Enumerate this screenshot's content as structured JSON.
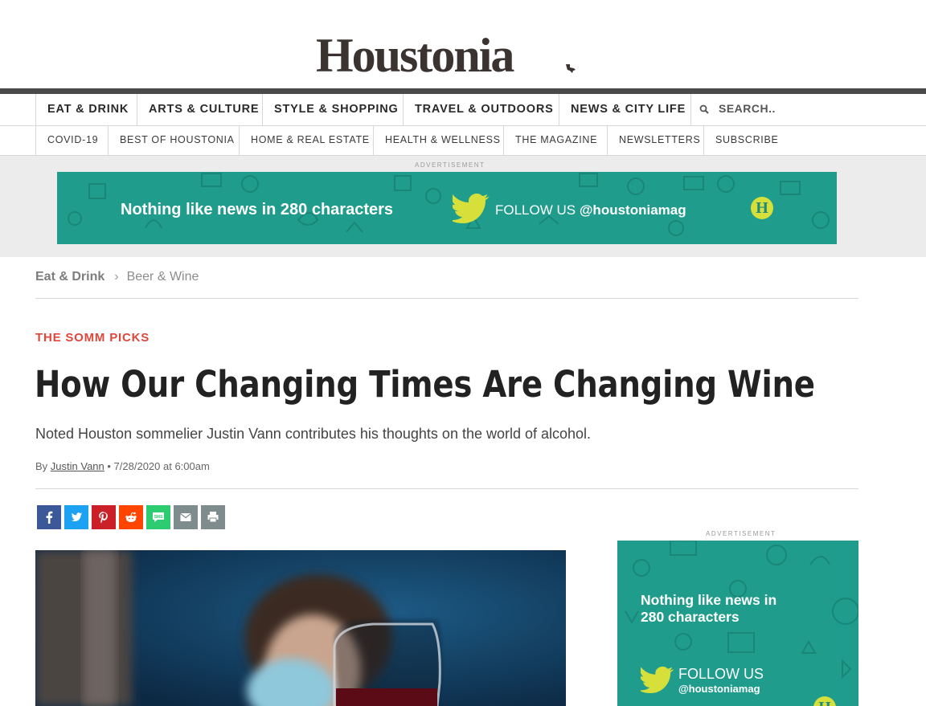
{
  "brand": {
    "logo_text": "Houstonia"
  },
  "primary_nav": {
    "items": [
      "EAT & DRINK",
      "ARTS & CULTURE",
      "STYLE & SHOPPING",
      "TRAVEL & OUTDOORS",
      "NEWS & CITY LIFE"
    ],
    "search_label": "SEARCH..",
    "search_icon": "search-icon"
  },
  "secondary_nav": {
    "items": [
      "COVID-19",
      "BEST OF HOUSTONIA",
      "HOME & REAL ESTATE",
      "HEALTH & WELLNESS",
      "THE MAGAZINE",
      "NEWSLETTERS",
      "SUBSCRIBE"
    ]
  },
  "ads": {
    "label": "ADVERTISEMENT",
    "leaderboard": {
      "text": "Nothing like news in 280 characters",
      "follow": "FOLLOW US",
      "handle": "@houstoniamag",
      "badge": "H"
    },
    "sidebar": {
      "text": "Nothing like news in 280 characters",
      "follow": "FOLLOW US",
      "handle": "@houstoniamag"
    },
    "color": "#1f9c8c"
  },
  "breadcrumb": {
    "section": "Eat & Drink",
    "subsection": "Beer & Wine",
    "separator": "›"
  },
  "article": {
    "kicker": "THE SOMM PICKS",
    "headline": "How Our Changing Times Are Changing Wine",
    "dek": "Noted Houston sommelier Justin Vann contributes his thoughts on the world of alcohol.",
    "byline_prefix": "By",
    "author": "Justin Vann",
    "date": "• 7/28/2020 at 6:00am"
  },
  "share_buttons": [
    {
      "name": "facebook",
      "glyph": "f",
      "color": "#3b5998"
    },
    {
      "name": "twitter",
      "glyph": "t",
      "color": "#1da1f2"
    },
    {
      "name": "pinterest",
      "glyph": "p",
      "color": "#cb2027"
    },
    {
      "name": "reddit",
      "glyph": "r",
      "color": "#ff4500"
    },
    {
      "name": "sms",
      "glyph": "sms",
      "color": "#2ecc71"
    },
    {
      "name": "email",
      "glyph": "email",
      "color": "#7f8c8d"
    },
    {
      "name": "print",
      "glyph": "print",
      "color": "#7f8c8d"
    }
  ],
  "colors": {
    "kicker": "#e0463a",
    "accent_teal": "#1f9c8c",
    "badge": "#d7df3a"
  }
}
